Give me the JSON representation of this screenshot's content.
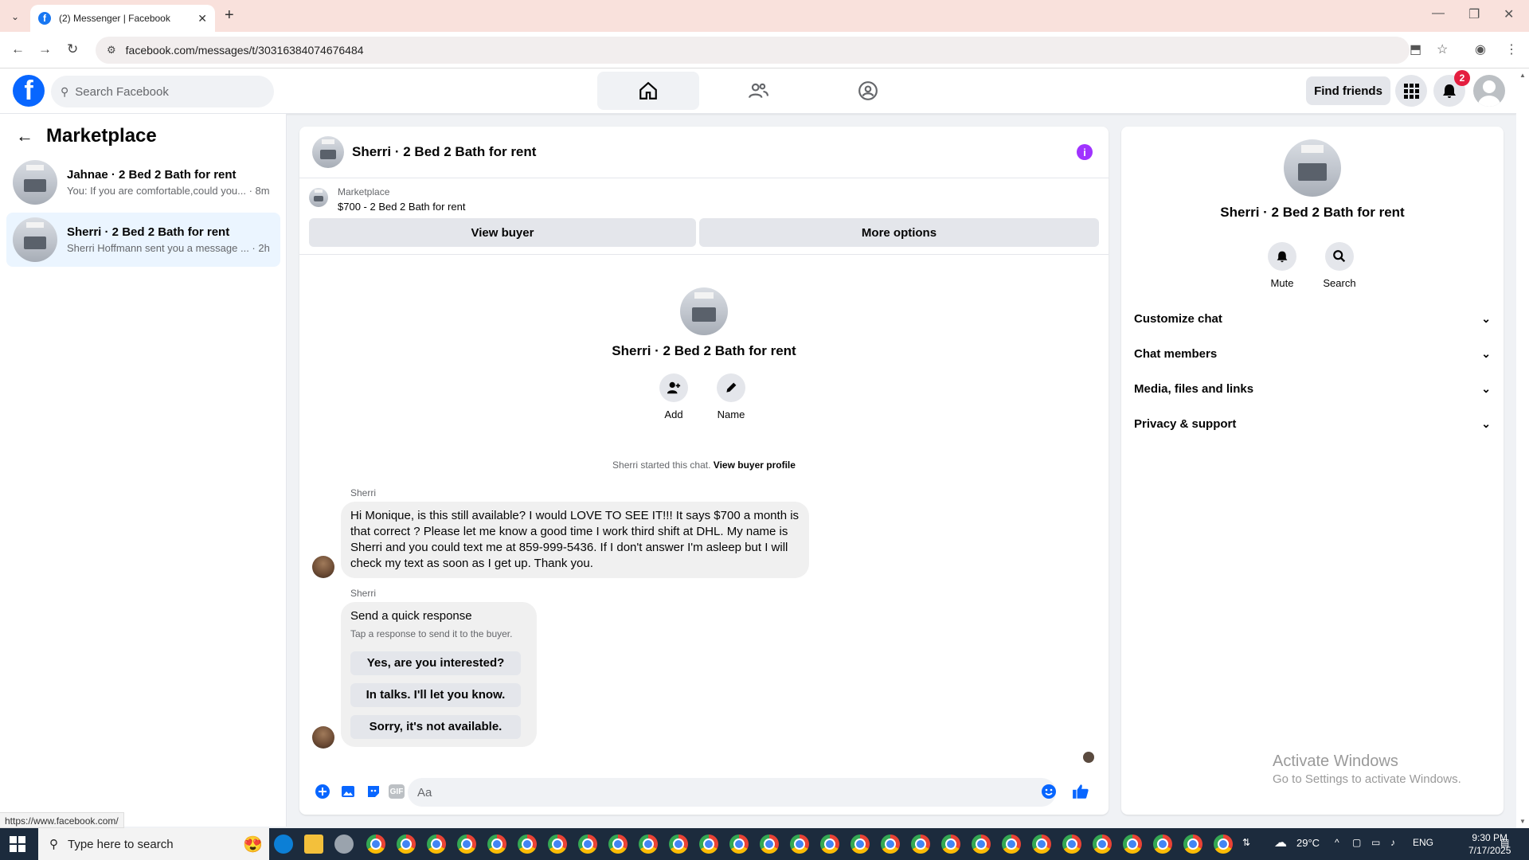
{
  "browser": {
    "tab_title": "(2) Messenger | Facebook",
    "url": "facebook.com/messages/t/30316384074676484",
    "status_url": "https://www.facebook.com/"
  },
  "header": {
    "search_placeholder": "Search Facebook",
    "find_friends": "Find friends",
    "notification_count": "2"
  },
  "sidebar": {
    "title": "Marketplace",
    "conversations": [
      {
        "name": "Jahnae · 2 Bed 2 Bath for rent",
        "preview": "You: If you are comfortable,could you... · 8m",
        "active": false
      },
      {
        "name": "Sherri · 2 Bed 2 Bath for rent",
        "preview": "Sherri Hoffmann sent you a message ... · 2h",
        "active": true
      }
    ]
  },
  "chat": {
    "title": "Sherri · 2 Bed 2 Bath for rent",
    "marketplace_label": "Marketplace",
    "listing": "$700 - 2 Bed 2 Bath for rent",
    "view_buyer": "View buyer",
    "more_options": "More options",
    "profile_name": "Sherri · 2 Bed 2 Bath for rent",
    "add_label": "Add",
    "name_label": "Name",
    "started_text": "Sherri started this chat.",
    "view_buyer_profile": "View buyer profile",
    "messages": [
      {
        "sender": "Sherri",
        "text": "Hi Monique, is this still available? I would LOVE TO SEE IT!!! It says $700 a month is that correct ? Please let me know a good time I work third shift at DHL. My name is Sherri and you could text me at 859-999-5436. If I don't answer I'm asleep but I will check my text as soon as I get up. Thank you."
      }
    ],
    "quick_response": {
      "sender": "Sherri",
      "title": "Send a quick response",
      "subtitle": "Tap a response to send it to the buyer.",
      "options": [
        "Yes, are you interested?",
        "In talks. I'll let you know.",
        "Sorry, it's not available."
      ]
    },
    "composer_placeholder": "Aa"
  },
  "details": {
    "name": "Sherri · 2 Bed 2 Bath for rent",
    "mute": "Mute",
    "search": "Search",
    "sections": [
      "Customize chat",
      "Chat members",
      "Media, files and links",
      "Privacy & support"
    ]
  },
  "watermark": {
    "line1": "Activate Windows",
    "line2": "Go to Settings to activate Windows."
  },
  "taskbar": {
    "search_placeholder": "Type here to search",
    "temperature": "29°C",
    "language": "ENG",
    "time": "9:30 PM",
    "date": "7/17/2025"
  },
  "colors": {
    "brand": "#0866ff",
    "accent_purple": "#a033ff",
    "active_row": "#ebf5ff"
  }
}
